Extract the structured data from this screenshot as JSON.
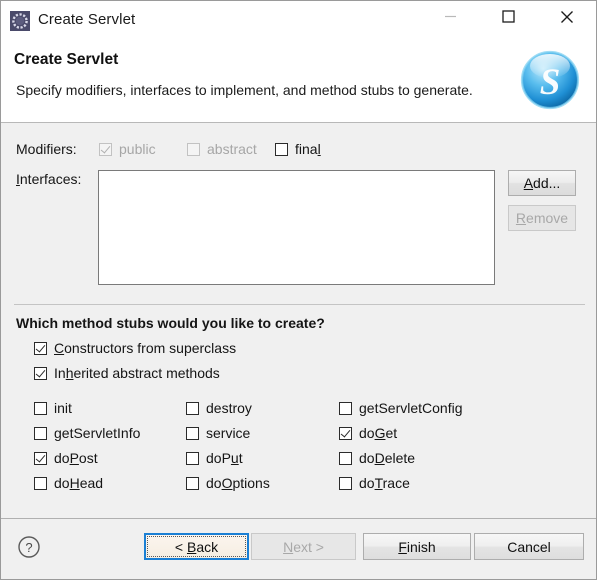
{
  "window": {
    "title": "Create Servlet",
    "icon": "eclipse-servlet-icon",
    "controls": {
      "minimize": "minimize-icon",
      "maximize": "maximize-icon",
      "close": "close-icon"
    }
  },
  "header": {
    "title": "Create Servlet",
    "description": "Specify modifiers, interfaces to implement, and method stubs to generate.",
    "logo": "servlet-s-logo"
  },
  "modifiers": {
    "label": "Modifiers:",
    "items": [
      {
        "label": "public",
        "checked": true,
        "enabled": false,
        "mnemonic": ""
      },
      {
        "label": "abstract",
        "checked": false,
        "enabled": false,
        "mnemonic": ""
      },
      {
        "label": "final",
        "checked": false,
        "enabled": true,
        "mnemonic": "l"
      }
    ]
  },
  "interfaces": {
    "label": "Interfaces:",
    "mnemonic": "I",
    "items": [],
    "add_button": {
      "label": "Add...",
      "enabled": true,
      "mnemonic": "A"
    },
    "remove_button": {
      "label": "Remove",
      "enabled": false,
      "mnemonic": "R"
    }
  },
  "method_stubs": {
    "question": "Which method stubs would you like to create?",
    "top_options": [
      {
        "label": "Constructors from superclass",
        "checked": true,
        "mnemonic": "C"
      },
      {
        "label": "Inherited abstract methods",
        "checked": true,
        "mnemonic": "h"
      }
    ],
    "columns": [
      [
        {
          "label": "init",
          "checked": false,
          "mnemonic": ""
        },
        {
          "label": "getServletInfo",
          "checked": false,
          "mnemonic": ""
        },
        {
          "label": "doPost",
          "checked": true,
          "mnemonic": "P"
        },
        {
          "label": "doHead",
          "checked": false,
          "mnemonic": "H"
        }
      ],
      [
        {
          "label": "destroy",
          "checked": false,
          "mnemonic": ""
        },
        {
          "label": "service",
          "checked": false,
          "mnemonic": ""
        },
        {
          "label": "doPut",
          "checked": false,
          "mnemonic": "u"
        },
        {
          "label": "doOptions",
          "checked": false,
          "mnemonic": "O"
        }
      ],
      [
        {
          "label": "getServletConfig",
          "checked": false,
          "mnemonic": ""
        },
        {
          "label": "doGet",
          "checked": true,
          "mnemonic": "G"
        },
        {
          "label": "doDelete",
          "checked": false,
          "mnemonic": "D"
        },
        {
          "label": "doTrace",
          "checked": false,
          "mnemonic": "T"
        }
      ]
    ]
  },
  "footer": {
    "help": "help-icon",
    "buttons": [
      {
        "label": "< Back",
        "enabled": true,
        "focused": true,
        "mnemonic": "B"
      },
      {
        "label": "Next >",
        "enabled": false,
        "focused": false,
        "mnemonic": "N"
      },
      {
        "label": "Finish",
        "enabled": true,
        "focused": false,
        "mnemonic": "F"
      },
      {
        "label": "Cancel",
        "enabled": true,
        "focused": false,
        "mnemonic": ""
      }
    ]
  },
  "colors": {
    "dialog_bg": "#f0f0f0",
    "header_bg": "#ffffff",
    "focus_blue": "#1a7fd4",
    "logo_blue": "#2ea8e6",
    "text": "#151515",
    "disabled_text": "#a6a6a6"
  }
}
